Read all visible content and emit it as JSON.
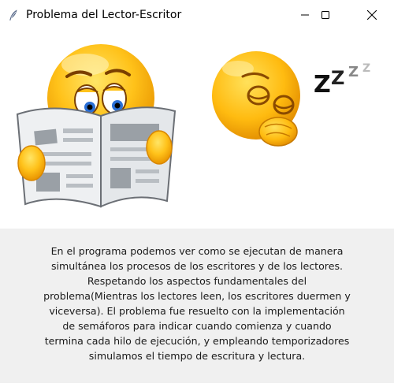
{
  "window": {
    "title": "Problema del Lector-Escritor",
    "app_icon": "feather-icon",
    "controls": [
      "minimize-icon",
      "maximize-icon",
      "close-icon"
    ]
  },
  "illustration": {
    "reader": "emoji-reading-newspaper",
    "sleeper": "emoji-sleeping",
    "sleep_text": [
      "Z",
      "Z",
      "Z",
      "Z"
    ]
  },
  "description": "En el programa podemos ver como se ejecutan de manera simultánea los procesos de los escritores y de los lectores. Respetando los aspectos fundamentales del problema(Mientras los lectores leen, los escritores duermen y viceversa). El problema fue resuelto con la implementación de semáforos para indicar cuando comienza y cuando termina cada hilo de ejecución, y empleando temporizadores simulamos el tiempo de escritura y lectura.",
  "colors": {
    "titlebar_bg": "#ffffff",
    "window_bg": "#f0f0f0",
    "emoji_yellow": "#f7b500",
    "text": "#1a1a1a"
  }
}
